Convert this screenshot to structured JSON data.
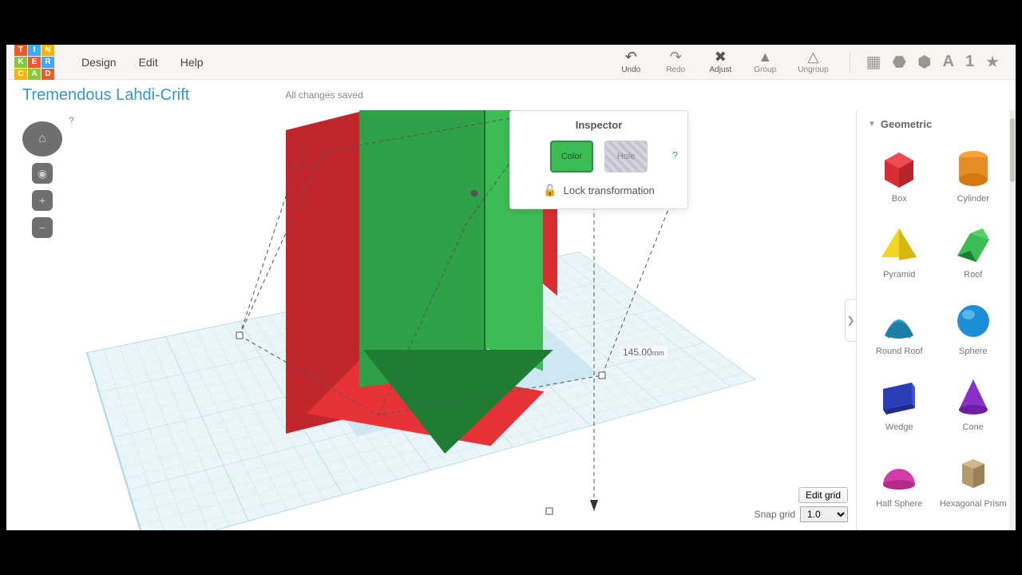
{
  "header": {
    "logo_letters": [
      "T",
      "I",
      "N",
      "K",
      "E",
      "R",
      "C",
      "A",
      "D"
    ],
    "menu": {
      "design": "Design",
      "edit": "Edit",
      "help": "Help"
    },
    "tools": {
      "undo": "Undo",
      "redo": "Redo",
      "adjust": "Adjust",
      "group": "Group",
      "ungroup": "Ungroup"
    }
  },
  "project": {
    "name": "Tremendous Lahdi-Crift",
    "save_state": "All changes saved"
  },
  "viewcube": {
    "help": "?"
  },
  "dimension": {
    "value": "145.00",
    "unit": "mm"
  },
  "inspector": {
    "title": "Inspector",
    "color_label": "Color",
    "hole_label": "Hole",
    "help": "?",
    "lock_label": "Lock transformation"
  },
  "grid": {
    "edit": "Edit grid",
    "snap_label": "Snap grid",
    "snap_value": "1.0"
  },
  "shapes_panel": {
    "category": "Geometric",
    "items": [
      {
        "key": "box",
        "label": "Box"
      },
      {
        "key": "cylinder",
        "label": "Cylinder"
      },
      {
        "key": "pyramid",
        "label": "Pyramid"
      },
      {
        "key": "roof",
        "label": "Roof"
      },
      {
        "key": "round_roof",
        "label": "Round Roof"
      },
      {
        "key": "sphere",
        "label": "Sphere"
      },
      {
        "key": "wedge",
        "label": "Wedge"
      },
      {
        "key": "cone",
        "label": "Cone"
      },
      {
        "key": "half_sphere",
        "label": "Half Sphere"
      },
      {
        "key": "hex_prism",
        "label": "Hexagonal Prism"
      }
    ]
  }
}
